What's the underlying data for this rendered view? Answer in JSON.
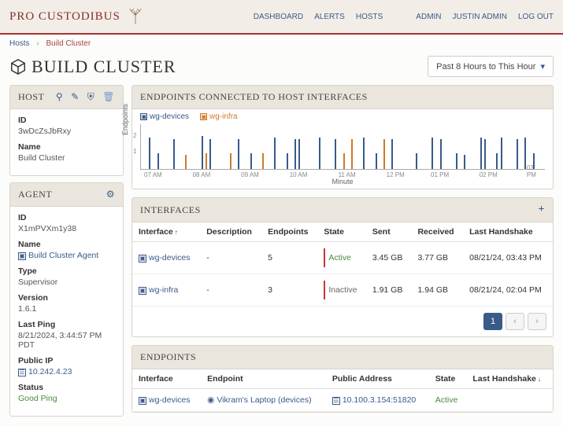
{
  "brand": "PRO CUSTODIBUS",
  "nav": {
    "dashboard": "DASHBOARD",
    "alerts": "ALERTS",
    "hosts": "HOSTS",
    "admin": "ADMIN",
    "user": "JUSTIN ADMIN",
    "logout": "LOG OUT"
  },
  "crumb": {
    "hosts": "Hosts",
    "sep": "›",
    "current": "Build Cluster"
  },
  "page_title": "BUILD CLUSTER",
  "time_selector": "Past 8 Hours to This Hour",
  "host_card": {
    "title": "HOST",
    "fields": {
      "id_label": "ID",
      "id": "3wDcZsJbRxy",
      "name_label": "Name",
      "name": "Build Cluster"
    }
  },
  "agent_card": {
    "title": "AGENT",
    "fields": {
      "id_label": "ID",
      "id": "X1mPVXm1y38",
      "name_label": "Name",
      "name": "Build Cluster Agent",
      "type_label": "Type",
      "type": "Supervisor",
      "version_label": "Version",
      "version": "1.6.1",
      "lastping_label": "Last Ping",
      "lastping": "8/21/2024, 3:44:57 PM PDT",
      "publicip_label": "Public IP",
      "publicip": "10.242.4.23",
      "status_label": "Status",
      "status": "Good Ping"
    }
  },
  "chart_card": {
    "title": "ENDPOINTS CONNECTED TO HOST INTERFACES",
    "legend": {
      "a": "wg-devices",
      "b": "wg-infra"
    },
    "ylabel": "Endpoints",
    "xlabel": "Minute",
    "yticks": [
      "1",
      "2"
    ],
    "xticks": [
      "07 AM",
      "08 AM",
      "09 AM",
      "10 AM",
      "11 AM",
      "12 PM",
      "01 PM",
      "02 PM",
      "03 PM"
    ]
  },
  "chart_data": {
    "type": "bar",
    "title": "Endpoints Connected to Host Interfaces",
    "xlabel": "Minute",
    "ylabel": "Endpoints",
    "ylim": [
      0,
      2.5
    ],
    "categories": [
      "07 AM",
      "08 AM",
      "09 AM",
      "10 AM",
      "11 AM",
      "12 PM",
      "01 PM",
      "02 PM",
      "03 PM"
    ],
    "series": [
      {
        "name": "wg-devices",
        "color": "#3a5a8a",
        "note": "sparse per-minute counts between 0 and 2; roughly 35 bars across 07AM–03PM"
      },
      {
        "name": "wg-infra",
        "color": "#d07a2a",
        "note": "fewer sparse bars, mostly value 1–2, clustered near 08–09AM and 11AM–12PM"
      }
    ]
  },
  "interfaces_card": {
    "title": "INTERFACES",
    "cols": {
      "iface": "Interface",
      "desc": "Description",
      "eps": "Endpoints",
      "state": "State",
      "sent": "Sent",
      "recv": "Received",
      "hs": "Last Handshake"
    },
    "rows": [
      {
        "iface": "wg-devices",
        "desc": "-",
        "eps": "5",
        "state": "Active",
        "sent": "3.45 GB",
        "recv": "3.77 GB",
        "hs": "08/21/24, 03:43 PM"
      },
      {
        "iface": "wg-infra",
        "desc": "-",
        "eps": "3",
        "state": "Inactive",
        "sent": "1.91 GB",
        "recv": "1.94 GB",
        "hs": "08/21/24, 02:04 PM"
      }
    ],
    "page": "1"
  },
  "endpoints_card": {
    "title": "ENDPOINTS",
    "cols": {
      "iface": "Interface",
      "ep": "Endpoint",
      "addr": "Public Address",
      "state": "State",
      "hs": "Last Handshake"
    },
    "rows": [
      {
        "iface": "wg-devices",
        "ep": "Vikram's Laptop (devices)",
        "addr": "10.100.3.154:51820",
        "state": "Active"
      }
    ]
  }
}
